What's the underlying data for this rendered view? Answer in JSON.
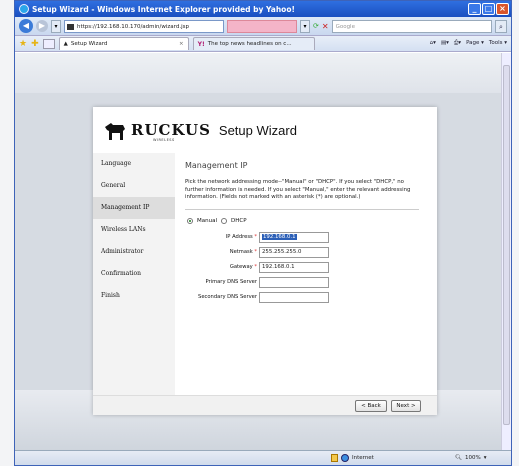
{
  "browser": {
    "window_title": "Setup Wizard - Windows Internet Explorer provided by Yahoo!",
    "url": "https://192.168.10.170/admin/wizard.jsp",
    "search_placeholder": "Google",
    "tabs": [
      {
        "label": "Setup Wizard",
        "active": true
      },
      {
        "label": "The top news headlines on c...",
        "active": false
      }
    ],
    "page_menu": "Page",
    "tools_menu": "Tools",
    "status_zone": "Internet",
    "zoom": "100%"
  },
  "wizard": {
    "brand": "RUCKUS",
    "brand_sub": "WIRELESS",
    "title": "Setup Wizard",
    "steps": [
      {
        "label": "Language",
        "active": false
      },
      {
        "label": "General",
        "active": false
      },
      {
        "label": "Management IP",
        "active": true
      },
      {
        "label": "Wireless LANs",
        "active": false
      },
      {
        "label": "Administrator",
        "active": false
      },
      {
        "label": "Confirmation",
        "active": false
      },
      {
        "label": "Finish",
        "active": false
      }
    ],
    "section_title": "Management IP",
    "section_text": "Pick the network addressing mode--\"Manual\" or \"DHCP\". If you select \"DHCP,\" no further information is needed. If you select \"Manual,\" enter the relevant addressing information. (Fields not marked with an asterisk (*) are optional.)",
    "mode_options": [
      {
        "label": "Manual",
        "checked": true
      },
      {
        "label": "DHCP",
        "checked": false
      }
    ],
    "fields": {
      "ip_address": {
        "label": "IP Address",
        "value": "192.168.0.1",
        "required": true
      },
      "netmask": {
        "label": "Netmask",
        "value": "255.255.255.0",
        "required": true
      },
      "gateway": {
        "label": "Gateway",
        "value": "192.168.0.1",
        "required": true
      },
      "primary_dns": {
        "label": "Primary DNS Server",
        "value": "",
        "required": false
      },
      "secondary_dns": {
        "label": "Secondary DNS Server",
        "value": "",
        "required": false
      }
    },
    "required_marker": "*",
    "back_label": "< Back",
    "next_label": "Next >"
  }
}
